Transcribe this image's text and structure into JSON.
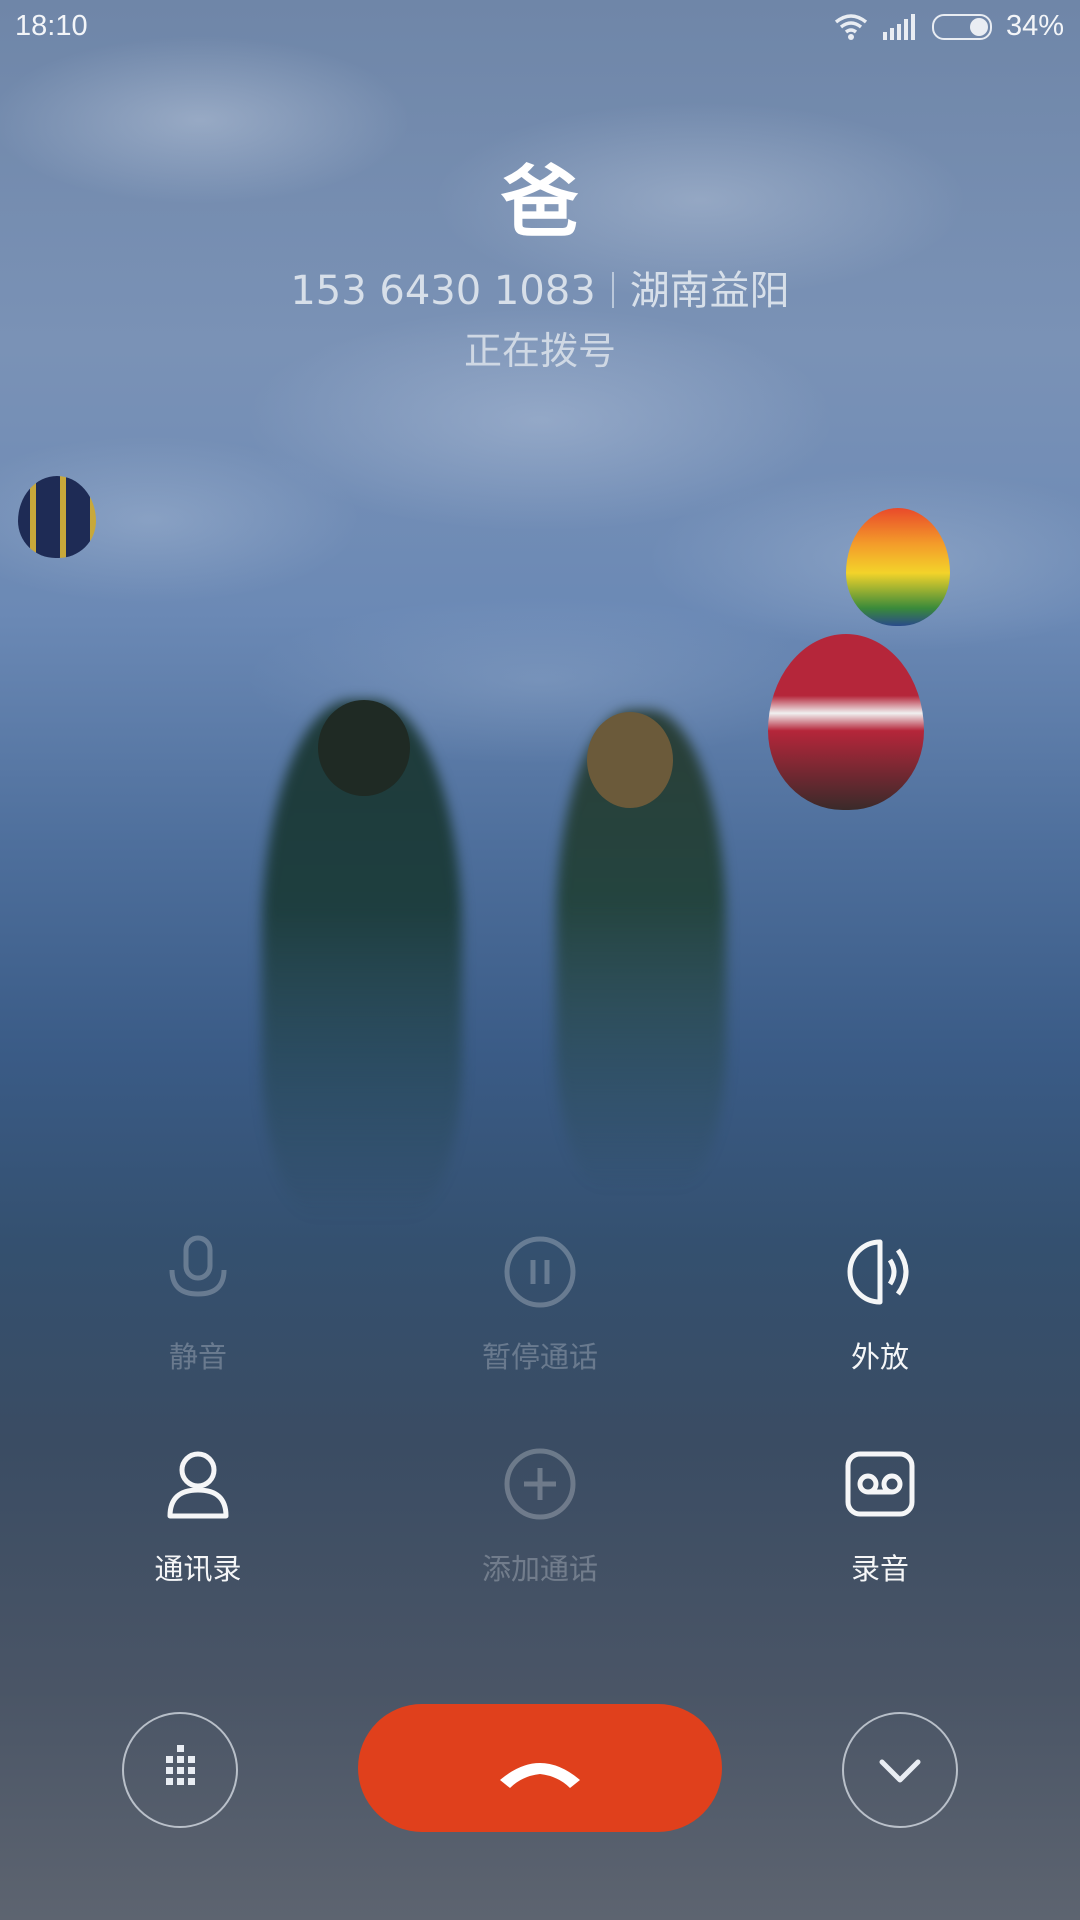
{
  "status_bar": {
    "time": "18:10",
    "battery_percent": "34%",
    "battery_level": 0.34,
    "icons": [
      "wifi-icon",
      "signal-icon",
      "battery-icon"
    ]
  },
  "caller": {
    "name": "爸",
    "number": "153 6430 1083",
    "location": "湖南益阳",
    "state": "正在拨号"
  },
  "controls": {
    "mute": "静音",
    "hold": "暂停通话",
    "speaker": "外放",
    "contacts": "通讯录",
    "add_call": "添加通话",
    "record": "录音"
  },
  "bottom": {
    "dialpad_icon": "dialpad-icon",
    "end_call_icon": "end-call-icon",
    "collapse_icon": "chevron-down-icon"
  },
  "colors": {
    "end_call": "#e0401c"
  }
}
